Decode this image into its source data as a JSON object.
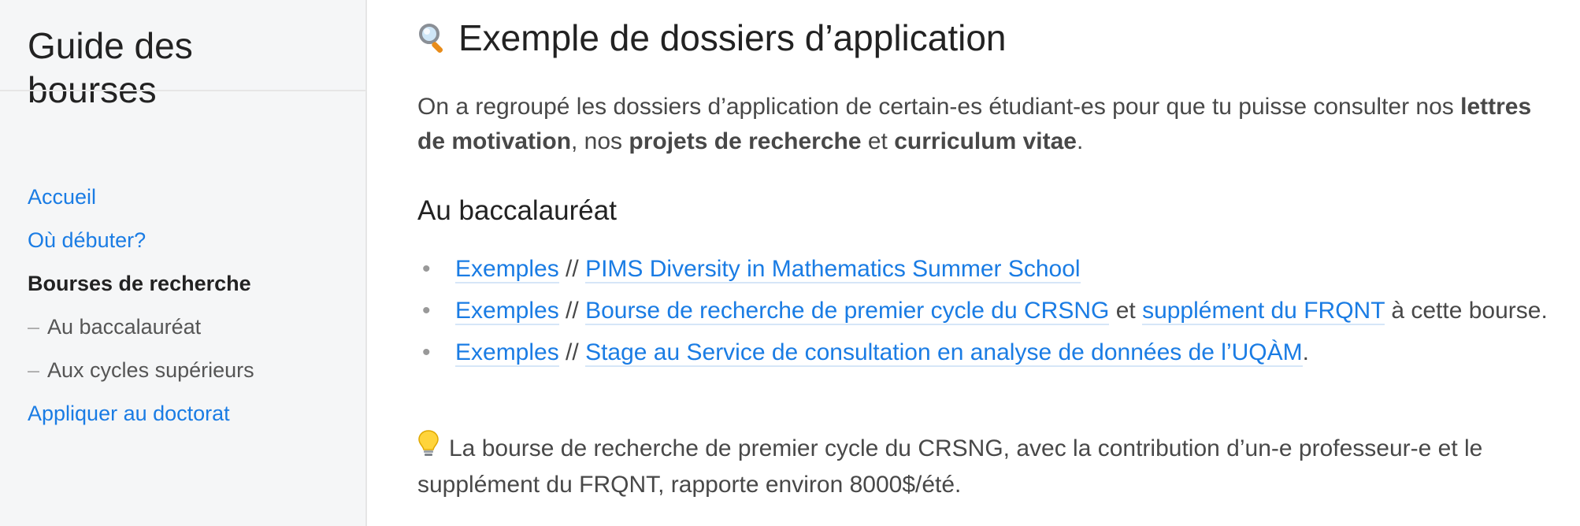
{
  "sidebar": {
    "title": "Guide des bourses",
    "nav": [
      {
        "label": "Accueil"
      },
      {
        "label": "Où débuter?"
      },
      {
        "label": "Bourses de recherche"
      },
      {
        "label": "Au baccalauréat"
      },
      {
        "label": "Aux cycles supérieurs"
      },
      {
        "label": "Appliquer au doctorat"
      }
    ],
    "dash": "–"
  },
  "main": {
    "title_emoji": "search-icon",
    "title": "Exemple de dossiers d’application",
    "intro": {
      "part1": "On a regroupé les dossiers d’application de certain-es étudiant-es pour que tu puisse consulter nos ",
      "bold1": "lettres de motivation",
      "part2": ", nos ",
      "bold2": "projets de recherche",
      "part3": " et ",
      "bold3": "curriculum vitae",
      "part4": "."
    },
    "section_heading": "Au baccalauréat",
    "separator": " // ",
    "items": [
      {
        "link1": "Exemples",
        "link2": "PIMS Diversity in Mathematics Summer School"
      },
      {
        "link1": "Exemples",
        "link2": "Bourse de recherche de premier cycle du CRSNG",
        "mid": " et ",
        "link3": "supplément du FRQNT",
        "tail": " à cette bourse."
      },
      {
        "link1": "Exemples",
        "link2": "Stage au Service de consultation en analyse de données de l’UQÀM",
        "tail": "."
      }
    ],
    "bullet": "•",
    "tip_emoji": "lightbulb-icon",
    "tip": "La bourse de recherche de premier cycle du CRSNG, avec la contribution d’un-e professeur-e et le supplément du FRQNT, rapporte environ 8000$/été."
  },
  "colors": {
    "link": "#1a7ce4",
    "sidebar_bg": "#f5f6f7",
    "text": "#484848",
    "heading": "#222222"
  }
}
